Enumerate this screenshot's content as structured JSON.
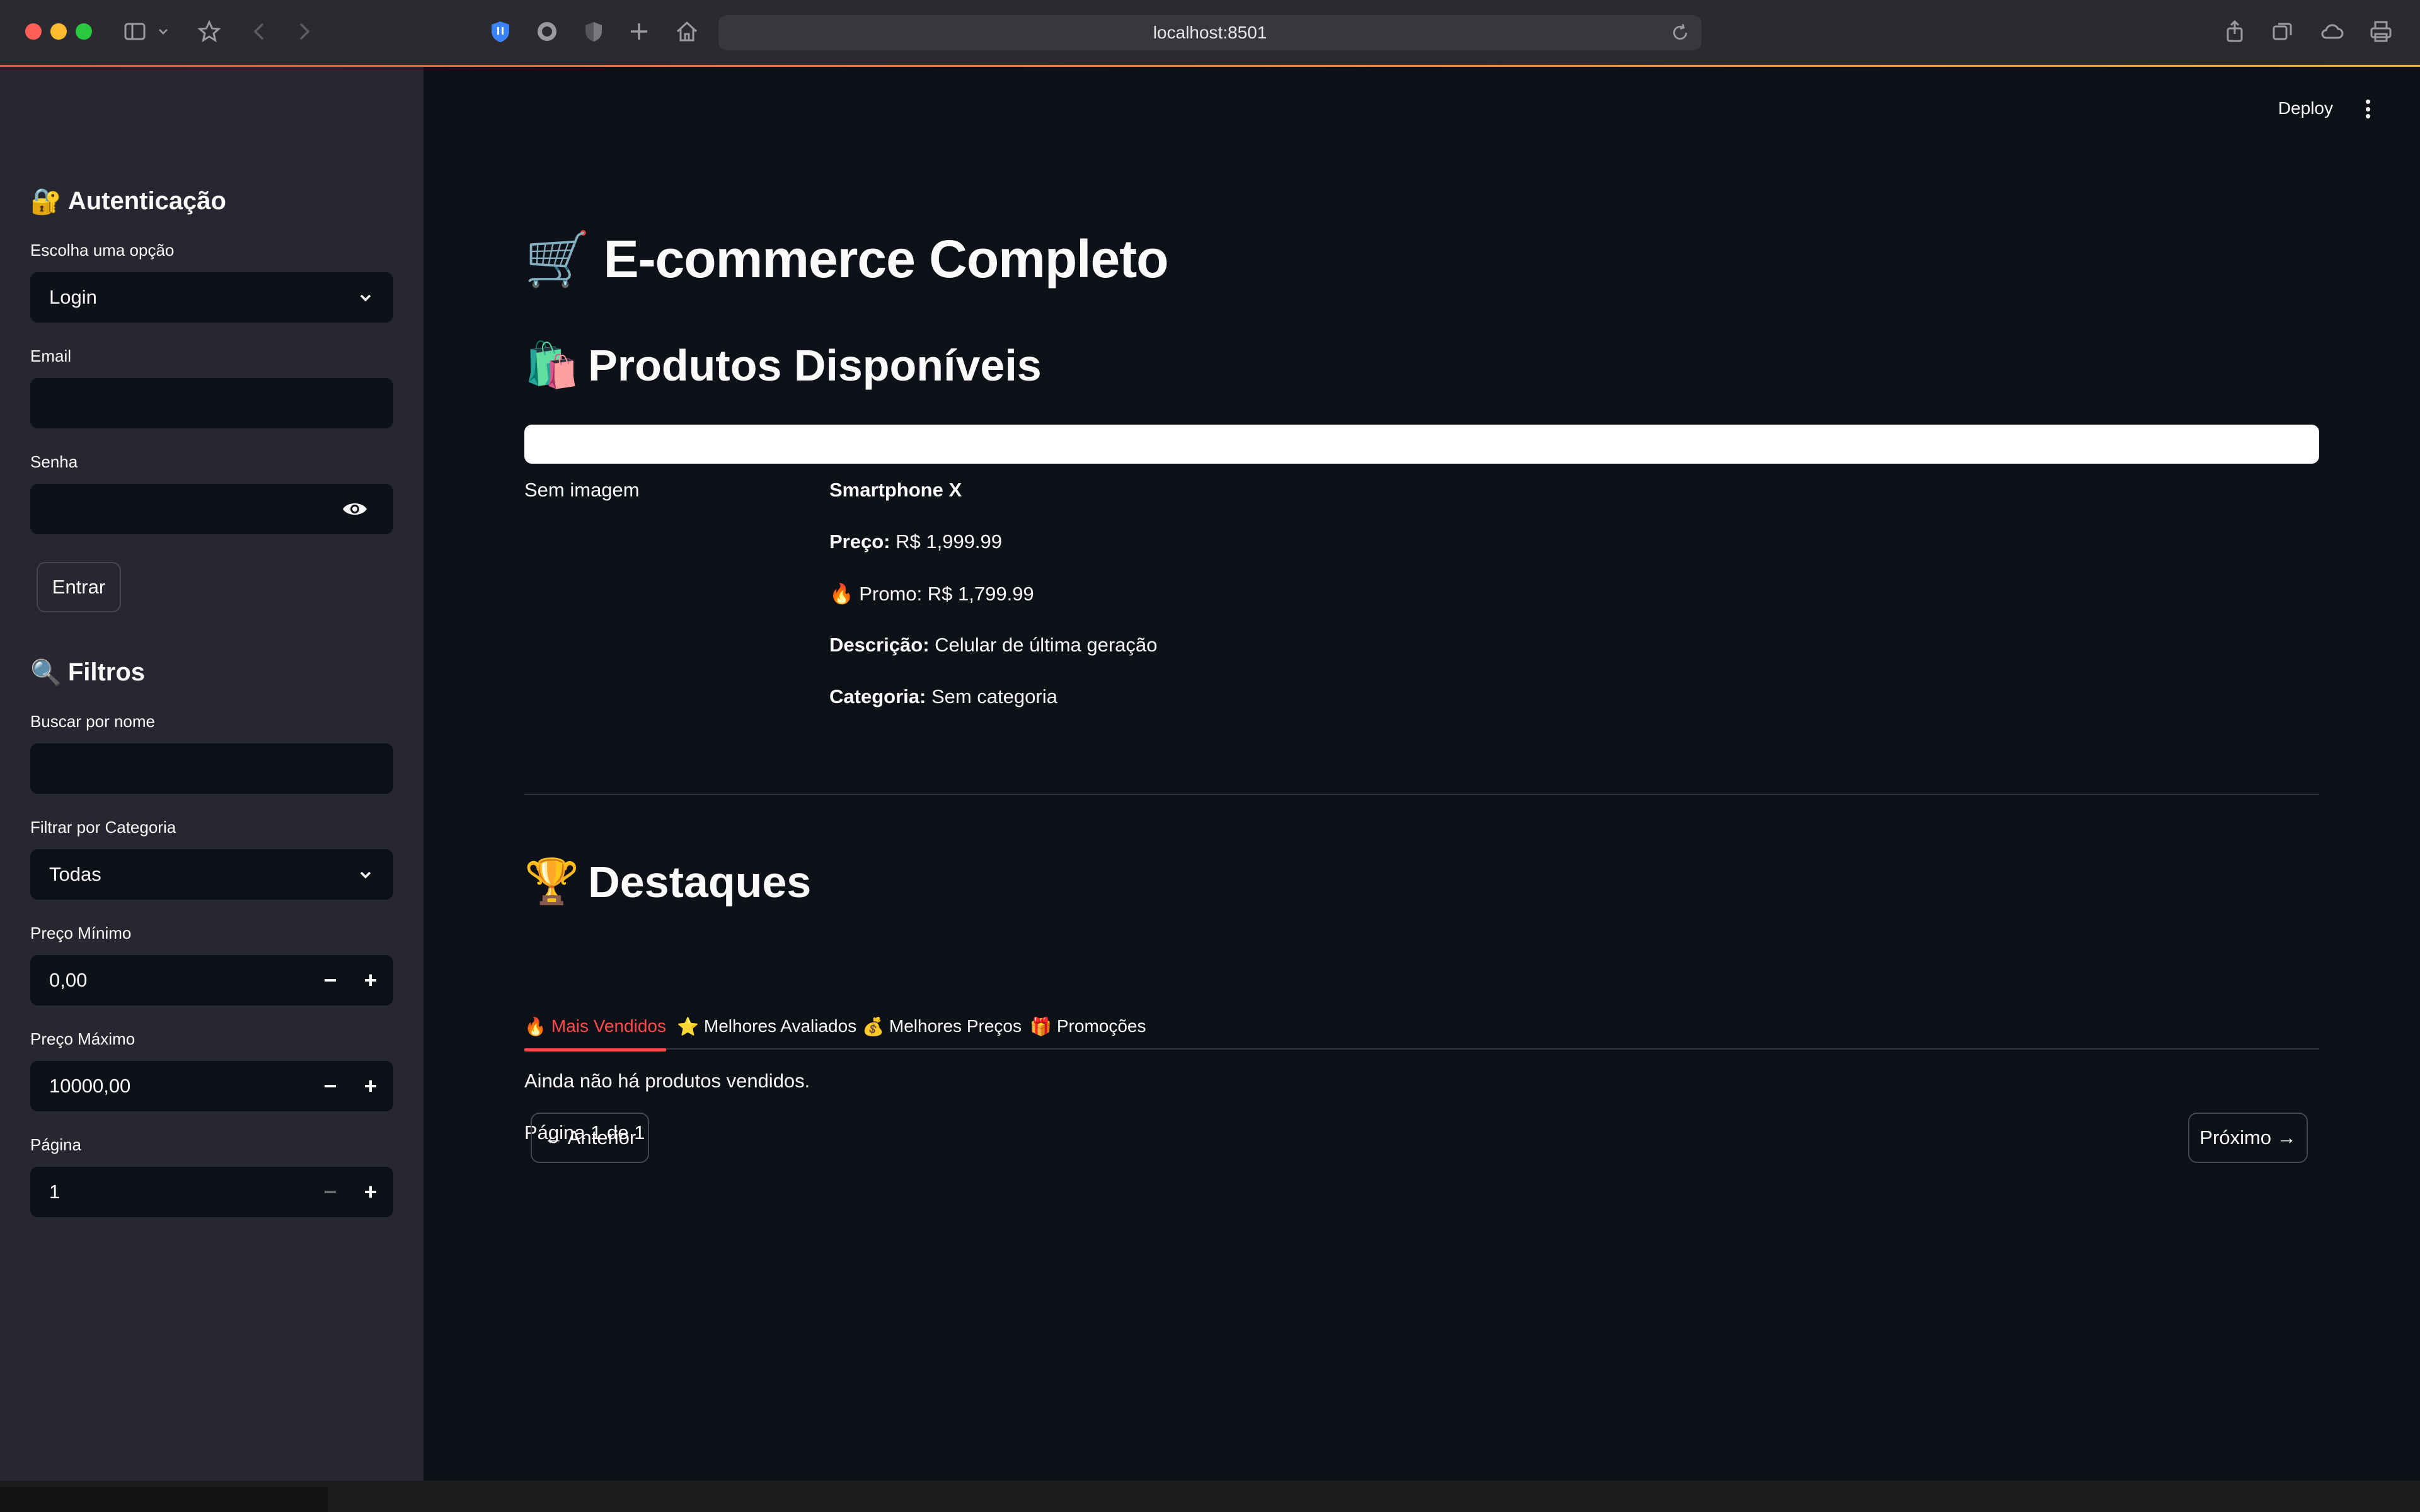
{
  "browser": {
    "url": "localhost:8501"
  },
  "header": {
    "deploy_label": "Deploy"
  },
  "sidebar": {
    "auth": {
      "heading_icon": "locked-with-key",
      "heading": "Autenticação",
      "option_label": "Escolha uma opção",
      "option_value": "Login",
      "email_label": "Email",
      "email_value": "",
      "password_label": "Senha",
      "password_value": "",
      "submit_label": "Entrar"
    },
    "filters": {
      "heading_icon": "magnifying-glass",
      "heading": "Filtros",
      "search_label": "Buscar por nome",
      "search_value": "",
      "category_label": "Filtrar por Categoria",
      "category_value": "Todas",
      "min_price_label": "Preço Mínimo",
      "min_price_value": "0,00",
      "max_price_label": "Preço Máximo",
      "max_price_value": "10000,00",
      "page_label": "Página",
      "page_value": "1"
    }
  },
  "main": {
    "title_icon": "shopping-cart",
    "title": "E-commerce Completo",
    "products_icon": "shopping-bags",
    "products_heading": "Produtos Disponíveis",
    "product": {
      "image_placeholder": "Sem imagem",
      "name": "Smartphone X",
      "price_label": "Preço:",
      "price_value": "R$ 1,999.99",
      "promo_icon": "fire",
      "promo_text": "Promo: R$ 1,799.99",
      "description_label": "Descrição:",
      "description_value": "Celular de última geração",
      "category_label": "Categoria:",
      "category_value": "Sem categoria"
    },
    "highlights_icon": "trophy",
    "highlights_heading": "Destaques",
    "tabs": [
      {
        "icon": "fire",
        "label": "Mais Vendidos",
        "active": true
      },
      {
        "icon": "star",
        "label": "Melhores Avaliados",
        "active": false
      },
      {
        "icon": "money-bag",
        "label": "Melhores Preços",
        "active": false
      },
      {
        "icon": "gift",
        "label": "Promoções",
        "active": false
      }
    ],
    "empty_message": "Ainda não há produtos vendidos.",
    "pagination": {
      "status": "Página 1 de 1",
      "prev_label": "← Anterior",
      "next_label": "Próximo →"
    }
  },
  "colors": {
    "accent": "#ff4b4b",
    "sidebar_bg": "#262730",
    "main_bg": "#0e1117",
    "input_bg": "#0e1117"
  }
}
